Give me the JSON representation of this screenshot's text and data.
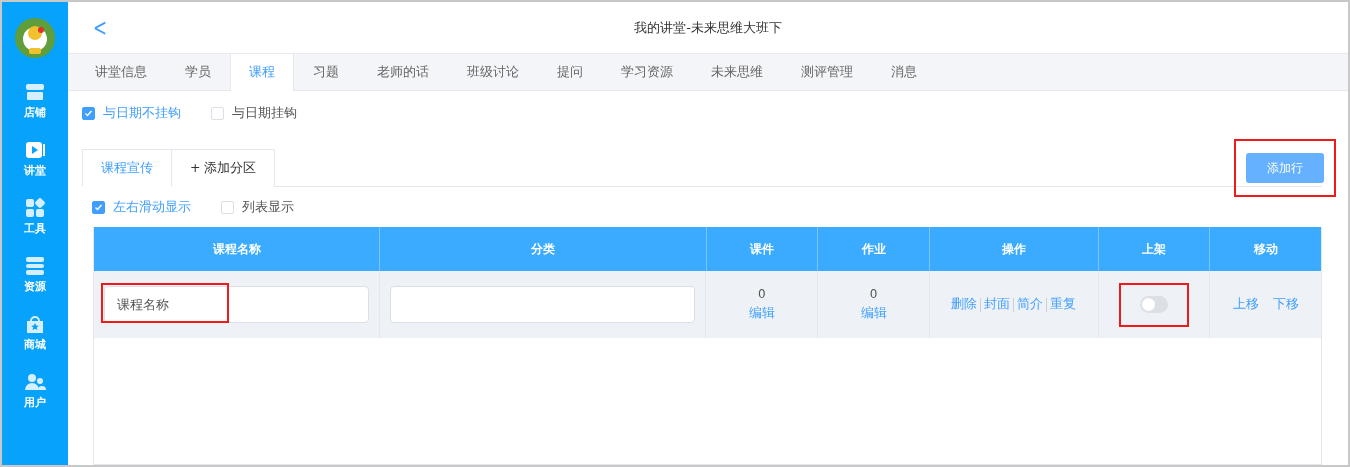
{
  "sidebar": {
    "items": [
      {
        "kind": "shop",
        "label": "店铺"
      },
      {
        "kind": "video",
        "label": "讲堂"
      },
      {
        "kind": "tools",
        "label": "工具"
      },
      {
        "kind": "stack",
        "label": "资源"
      },
      {
        "kind": "bag",
        "label": "商城"
      },
      {
        "kind": "users",
        "label": "用户"
      }
    ]
  },
  "header": {
    "back": "<",
    "title": "我的讲堂-未来思维大班下"
  },
  "tabs": [
    {
      "label": "讲堂信息",
      "selected": false
    },
    {
      "label": "学员",
      "selected": false
    },
    {
      "label": "课程",
      "selected": true
    },
    {
      "label": "习题",
      "selected": false
    },
    {
      "label": "老师的话",
      "selected": false
    },
    {
      "label": "班级讨论",
      "selected": false
    },
    {
      "label": "提问",
      "selected": false
    },
    {
      "label": "学习资源",
      "selected": false
    },
    {
      "label": "未来思维",
      "selected": false
    },
    {
      "label": "测评管理",
      "selected": false
    },
    {
      "label": "消息",
      "selected": false
    }
  ],
  "date_options": [
    {
      "label": "与日期不挂钩",
      "checked": true
    },
    {
      "label": "与日期挂钩",
      "checked": false
    }
  ],
  "section_tabs": [
    {
      "label": "课程宣传",
      "selected": true
    },
    {
      "label": "+ 添加分区",
      "selected": false
    }
  ],
  "add_row_button": {
    "label": "添加行",
    "highlighted": true
  },
  "display_options": [
    {
      "label": "左右滑动显示",
      "checked": true
    },
    {
      "label": "列表显示",
      "checked": false
    }
  ],
  "table": {
    "columns": [
      "课程名称",
      "分类",
      "课件",
      "作业",
      "操作",
      "上架",
      "移动"
    ],
    "rows": [
      {
        "name_placeholder": "课程名称",
        "name_highlighted": true,
        "category": "",
        "courseware_count": "0",
        "courseware_edit": "编辑",
        "homework_count": "0",
        "homework_edit": "编辑",
        "actions": [
          "删除",
          "封面",
          "简介",
          "重复"
        ],
        "published": false,
        "published_highlighted": true,
        "move": [
          "上移",
          "下移"
        ]
      }
    ]
  }
}
